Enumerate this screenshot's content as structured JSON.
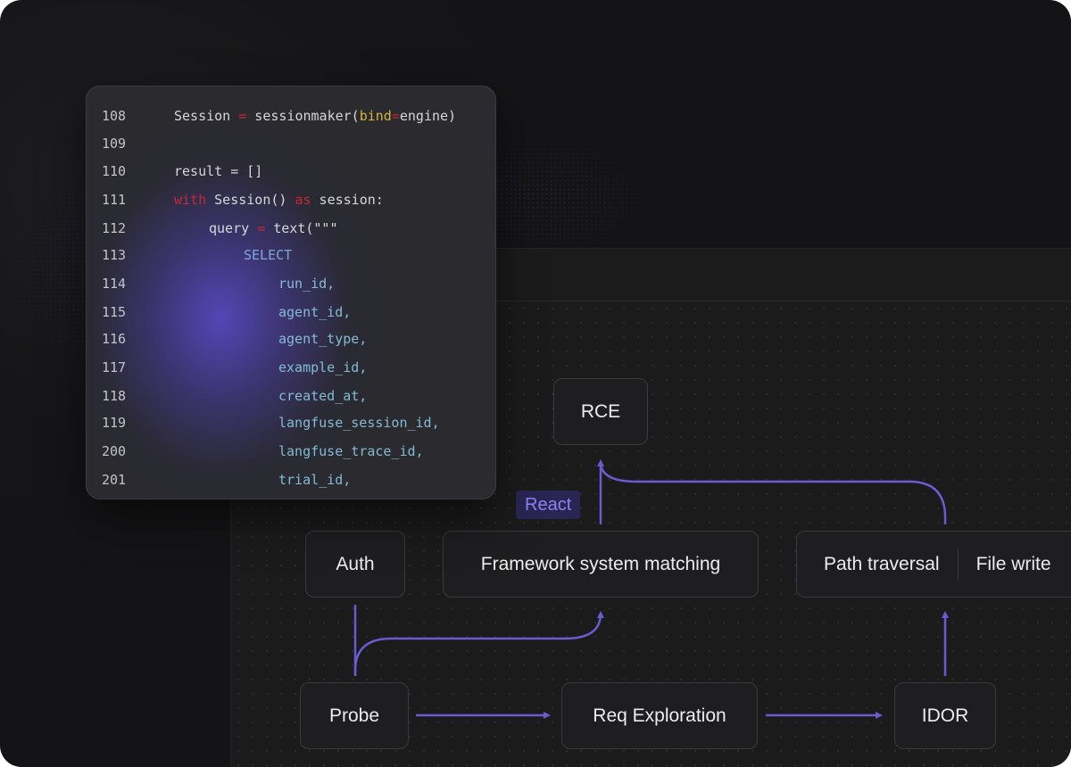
{
  "code_editor": {
    "lines": [
      {
        "number": "108",
        "indent": 0,
        "tokens": [
          {
            "t": "Session ",
            "c": "plain"
          },
          {
            "t": "=",
            "c": "op"
          },
          {
            "t": " sessionmaker(",
            "c": "plain"
          },
          {
            "t": "bind",
            "c": "param"
          },
          {
            "t": "=",
            "c": "op"
          },
          {
            "t": "engine)",
            "c": "plain"
          }
        ]
      },
      {
        "number": "109",
        "indent": 0,
        "tokens": []
      },
      {
        "number": "110",
        "indent": 0,
        "tokens": [
          {
            "t": "result = []",
            "c": "plain"
          }
        ]
      },
      {
        "number": "111",
        "indent": 0,
        "tokens": [
          {
            "t": "with",
            "c": "kw"
          },
          {
            "t": " Session() ",
            "c": "plain"
          },
          {
            "t": "as",
            "c": "kw"
          },
          {
            "t": " session:",
            "c": "plain"
          }
        ]
      },
      {
        "number": "112",
        "indent": 1,
        "tokens": [
          {
            "t": "query ",
            "c": "plain"
          },
          {
            "t": "=",
            "c": "op"
          },
          {
            "t": " text(\"\"\"",
            "c": "plain"
          }
        ]
      },
      {
        "number": "113",
        "indent": 2,
        "tokens": [
          {
            "t": "SELECT",
            "c": "sql"
          }
        ]
      },
      {
        "number": "114",
        "indent": 3,
        "tokens": [
          {
            "t": "run_id,",
            "c": "col"
          }
        ]
      },
      {
        "number": "115",
        "indent": 3,
        "tokens": [
          {
            "t": "agent_id,",
            "c": "col"
          }
        ]
      },
      {
        "number": "116",
        "indent": 3,
        "tokens": [
          {
            "t": "agent_type,",
            "c": "col"
          }
        ]
      },
      {
        "number": "117",
        "indent": 3,
        "tokens": [
          {
            "t": "example_id,",
            "c": "col"
          }
        ]
      },
      {
        "number": "118",
        "indent": 3,
        "tokens": [
          {
            "t": "created_at,",
            "c": "col"
          }
        ]
      },
      {
        "number": "119",
        "indent": 3,
        "tokens": [
          {
            "t": "langfuse_session_id,",
            "c": "col"
          }
        ]
      },
      {
        "number": "200",
        "indent": 3,
        "tokens": [
          {
            "t": "langfuse_trace_id,",
            "c": "col"
          }
        ]
      },
      {
        "number": "201",
        "indent": 3,
        "tokens": [
          {
            "t": "trial_id,",
            "c": "col"
          }
        ]
      }
    ]
  },
  "diagram": {
    "nodes": {
      "rce": "RCE",
      "auth": "Auth",
      "framework": "Framework system matching",
      "path_traversal": "Path traversal",
      "file_write": "File write",
      "probe": "Probe",
      "req_exploration": "Req Exploration",
      "idor": "IDOR"
    },
    "badge": "React",
    "edges": [
      {
        "from": "Probe",
        "to": "Req Exploration"
      },
      {
        "from": "Req Exploration",
        "to": "IDOR"
      },
      {
        "from": "IDOR",
        "to": "Path traversal"
      },
      {
        "from": "Path traversal",
        "to": "RCE"
      },
      {
        "from": "Framework system matching",
        "to": "RCE"
      },
      {
        "from": "Auth",
        "to": "Probe"
      },
      {
        "from": "Probe",
        "to": "Framework system matching"
      }
    ],
    "edge_color": "#6a5bd0"
  }
}
